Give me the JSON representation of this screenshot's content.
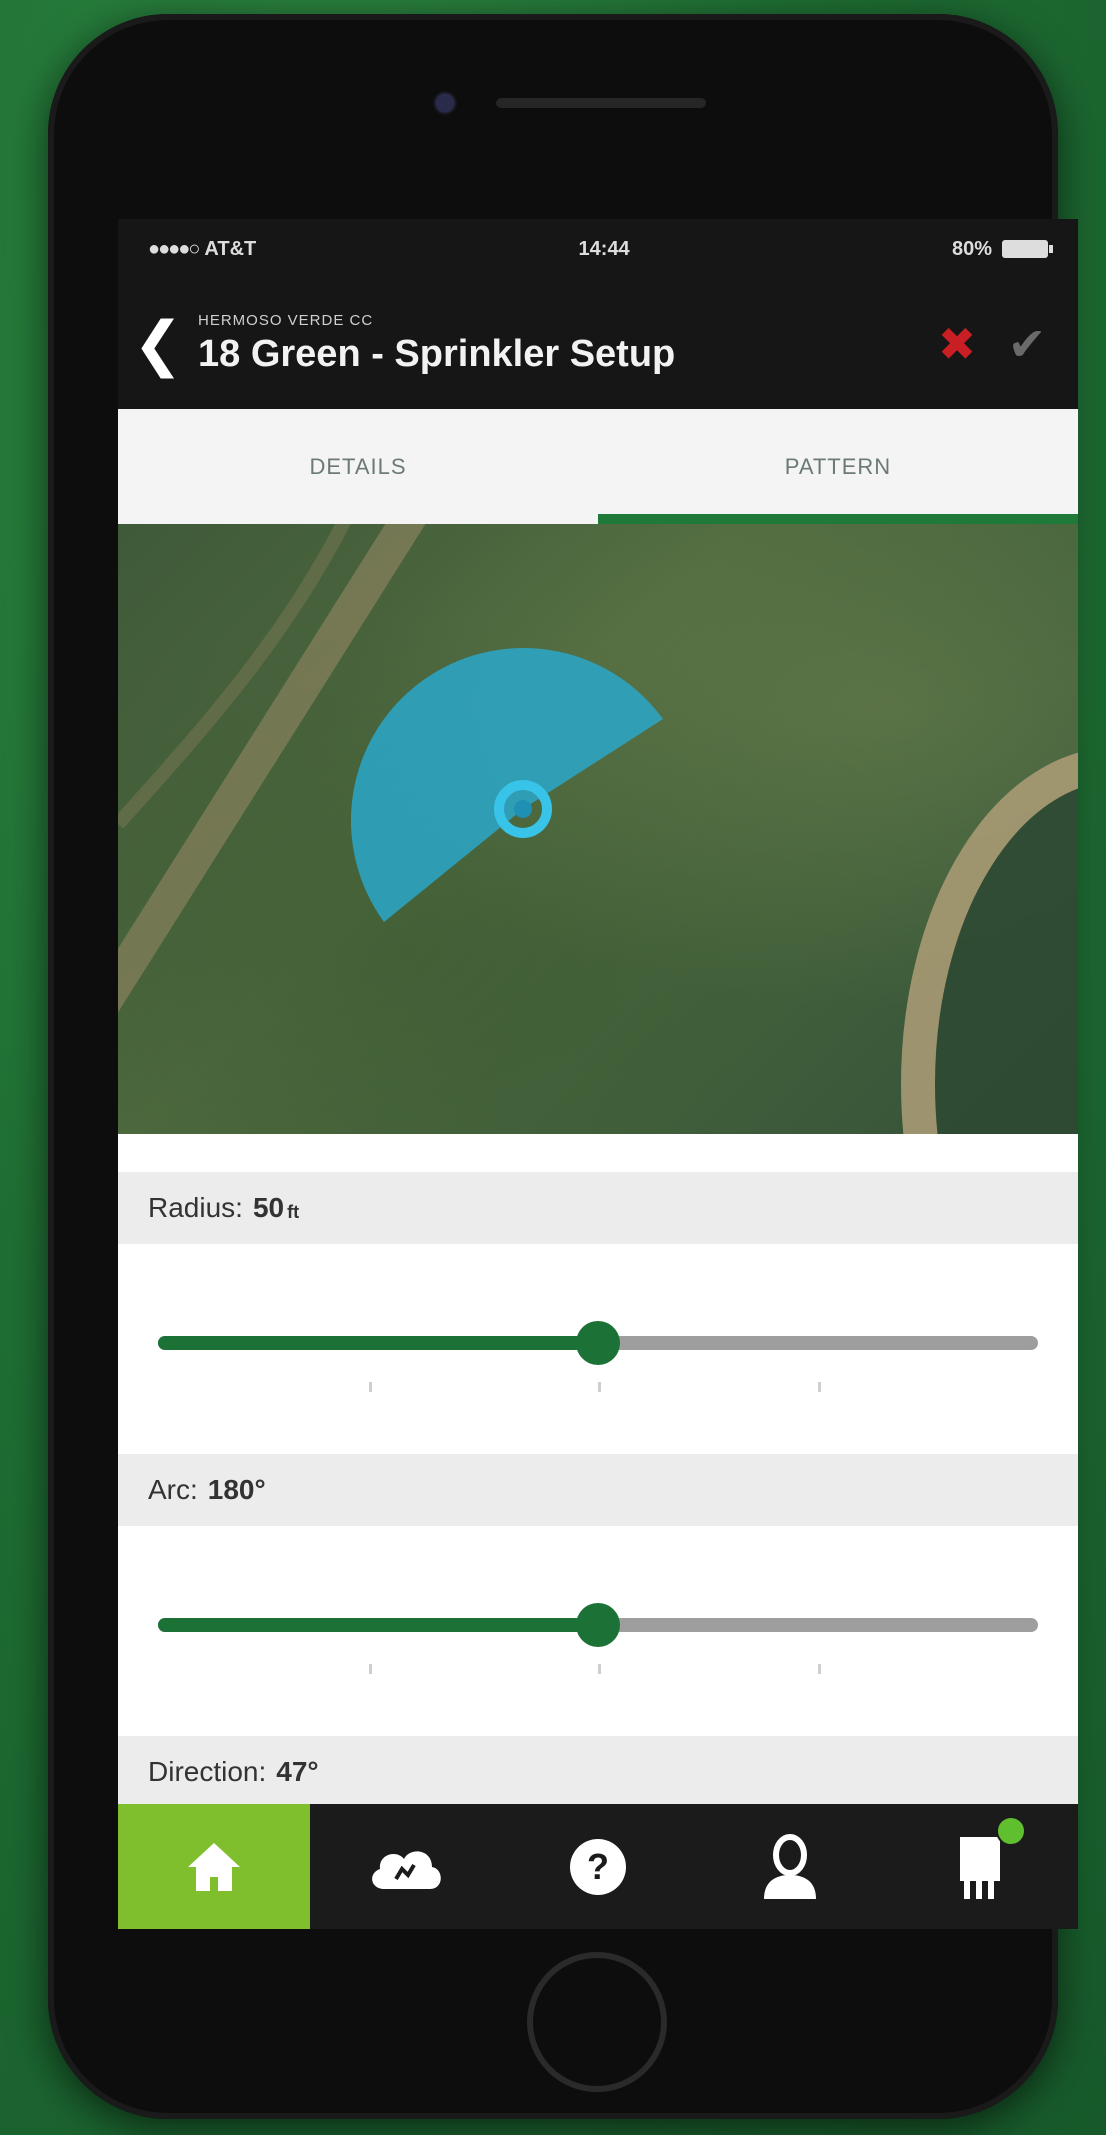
{
  "status_bar": {
    "carrier": "AT&T",
    "time": "14:44",
    "battery": "80%"
  },
  "header": {
    "subtitle": "HERMOSO VERDE CC",
    "title": "18 Green - Sprinkler Setup",
    "back_icon": "chevron-left-icon",
    "close_icon": "close-icon",
    "confirm_icon": "check-icon"
  },
  "tabs": [
    {
      "label": "DETAILS",
      "active": false
    },
    {
      "label": "PATTERN",
      "active": true
    }
  ],
  "settings": {
    "radius": {
      "label": "Radius:",
      "value": "50",
      "unit": "ft",
      "slider_fraction": 0.5
    },
    "arc": {
      "label": "Arc:",
      "value": "180°",
      "slider_fraction": 0.5
    },
    "direction": {
      "label": "Direction:",
      "value": "47°"
    }
  },
  "bottom_nav": [
    {
      "name": "home",
      "icon": "home-icon",
      "active": true
    },
    {
      "name": "weather",
      "icon": "cloud-icon",
      "active": false
    },
    {
      "name": "help",
      "icon": "help-icon",
      "active": false
    },
    {
      "name": "profile",
      "icon": "user-icon",
      "active": false
    },
    {
      "name": "notifications",
      "icon": "device-icon",
      "active": false
    }
  ],
  "colors": {
    "accent_green": "#1c7236",
    "home_tab_green": "#7fbf2e",
    "spray_pattern": "#2aa7c9",
    "close_red": "#c81e24"
  }
}
